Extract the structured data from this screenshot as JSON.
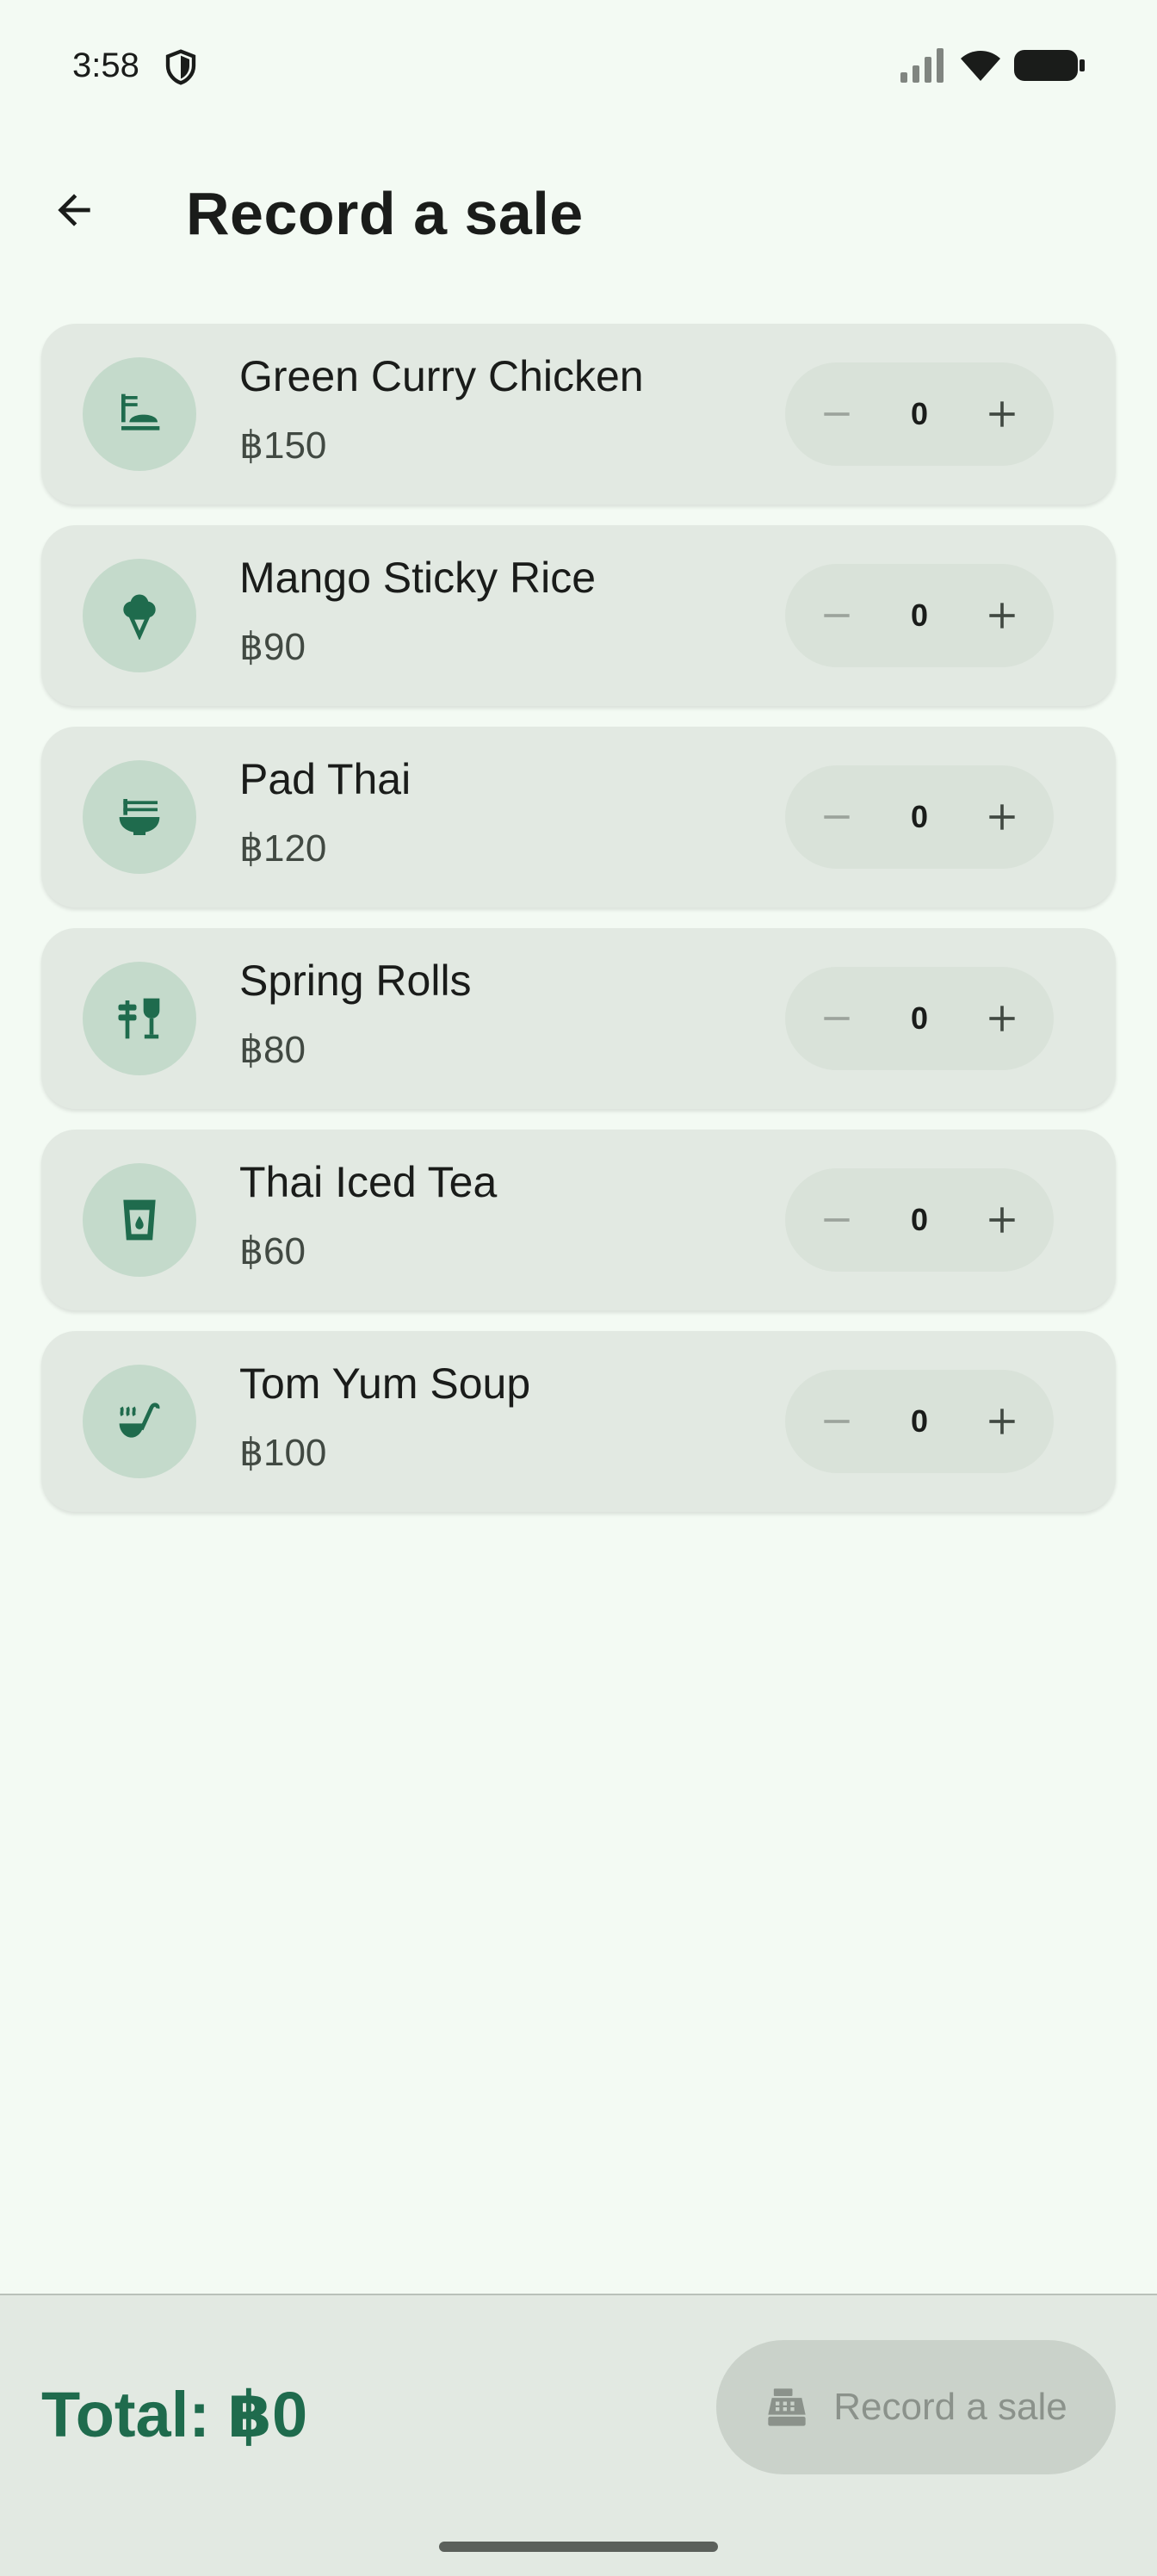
{
  "status_bar": {
    "time": "3:58"
  },
  "app_bar": {
    "title": "Record a sale"
  },
  "menu_items": [
    {
      "name": "Green Curry Chicken",
      "price": "฿150",
      "quantity": "0",
      "icon": "rice-bowl-icon"
    },
    {
      "name": "Mango Sticky Rice",
      "price": "฿90",
      "quantity": "0",
      "icon": "ice-cream-icon"
    },
    {
      "name": "Pad Thai",
      "price": "฿120",
      "quantity": "0",
      "icon": "noodle-bowl-icon"
    },
    {
      "name": "Spring Rolls",
      "price": "฿80",
      "quantity": "0",
      "icon": "tapas-icon"
    },
    {
      "name": "Thai Iced Tea",
      "price": "฿60",
      "quantity": "0",
      "icon": "drink-cup-icon"
    },
    {
      "name": "Tom Yum Soup",
      "price": "฿100",
      "quantity": "0",
      "icon": "soup-ladle-icon"
    }
  ],
  "bottom_bar": {
    "total": "Total: ฿0",
    "record_label": "Record a sale"
  },
  "colors": {
    "accent": "#1f6b4d",
    "background": "#f3faf3",
    "card": "#e2e9e2"
  }
}
